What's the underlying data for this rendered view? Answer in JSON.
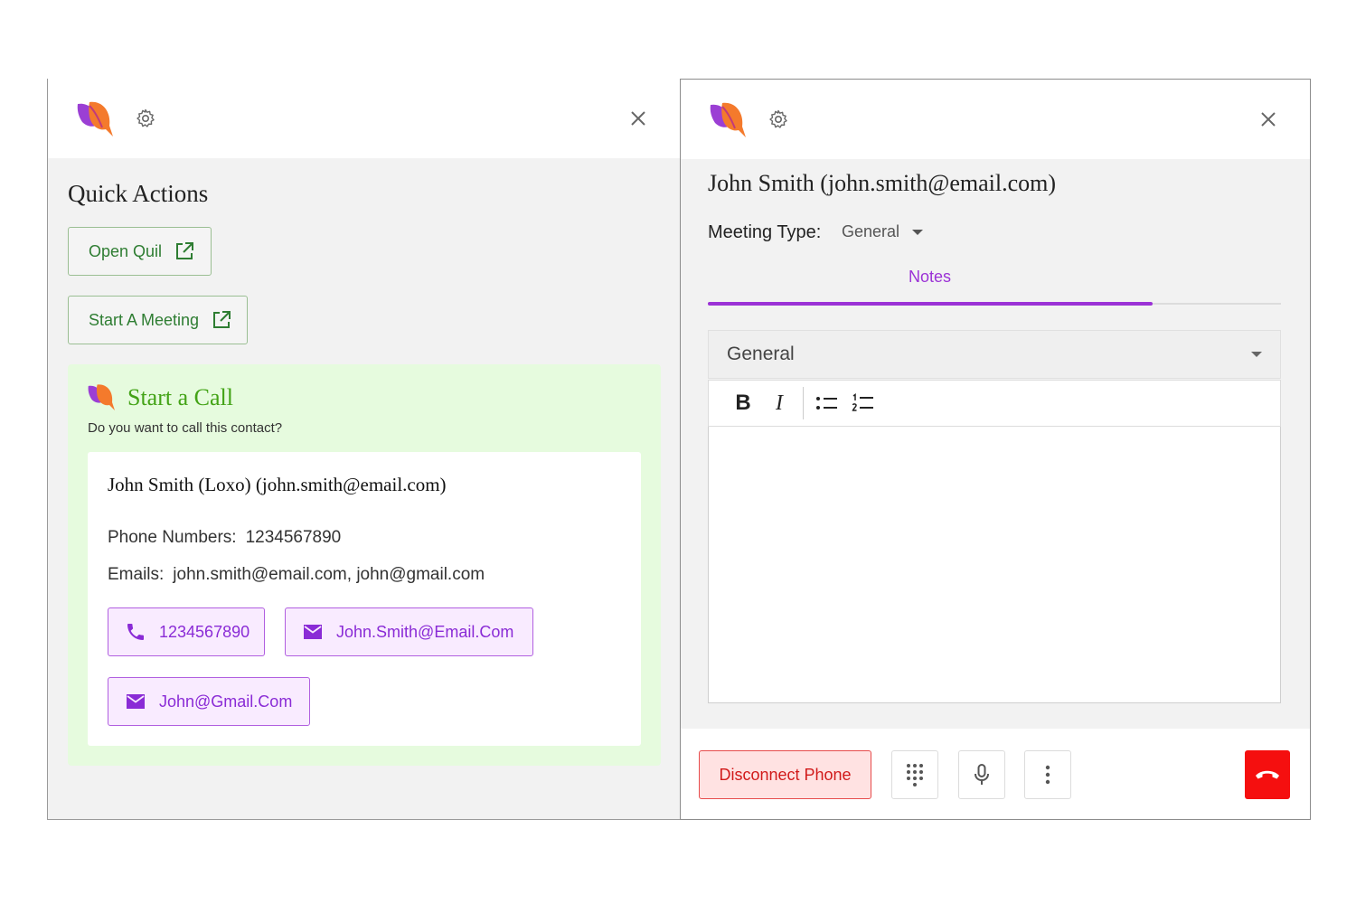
{
  "brand_colors": {
    "accent_purple": "#9b32d6",
    "accent_green": "#43a316",
    "danger_red": "#f50f0f"
  },
  "left_panel": {
    "header": {
      "logo_icon": "quil-logo-icon",
      "settings_icon": "gear-icon",
      "close_icon": "close-icon"
    },
    "quick_actions": {
      "title": "Quick Actions",
      "buttons": [
        {
          "label": "Open Quil",
          "icon": "external-link-icon"
        },
        {
          "label": "Start A Meeting",
          "icon": "external-link-icon"
        }
      ]
    },
    "start_call": {
      "title": "Start a Call",
      "subtitle": "Do you want to call this contact?",
      "contact": {
        "name": "John Smith (Loxo) (john.smith@email.com)",
        "phone_label": "Phone Numbers:",
        "phone_value": "1234567890",
        "emails_label": "Emails:",
        "emails_value": "john.smith@email.com, john@gmail.com"
      },
      "chips": [
        {
          "label": "1234567890",
          "icon": "phone-icon"
        },
        {
          "label": "John.Smith@Email.Com",
          "icon": "mail-icon"
        },
        {
          "label": "John@Gmail.Com",
          "icon": "mail-icon"
        }
      ]
    }
  },
  "right_panel": {
    "header": {
      "logo_icon": "quil-logo-icon",
      "settings_icon": "gear-icon",
      "close_icon": "close-icon"
    },
    "title": "John Smith (john.smith@email.com)",
    "meeting_type": {
      "label": "Meeting Type:",
      "value": "General"
    },
    "tabs": [
      {
        "label": "Notes",
        "active": true
      }
    ],
    "notes_template_select": "General",
    "toolbar": {
      "bold": "B",
      "italic": "I",
      "bullet_list_icon": "bullet-list-icon",
      "numbered_list_icon": "numbered-list-icon"
    },
    "editor_content": "",
    "footer": {
      "disconnect_label": "Disconnect Phone",
      "dialpad_icon": "dialpad-icon",
      "mic_icon": "microphone-icon",
      "more_icon": "more-vertical-icon",
      "hangup_icon": "hang-up-icon"
    }
  }
}
